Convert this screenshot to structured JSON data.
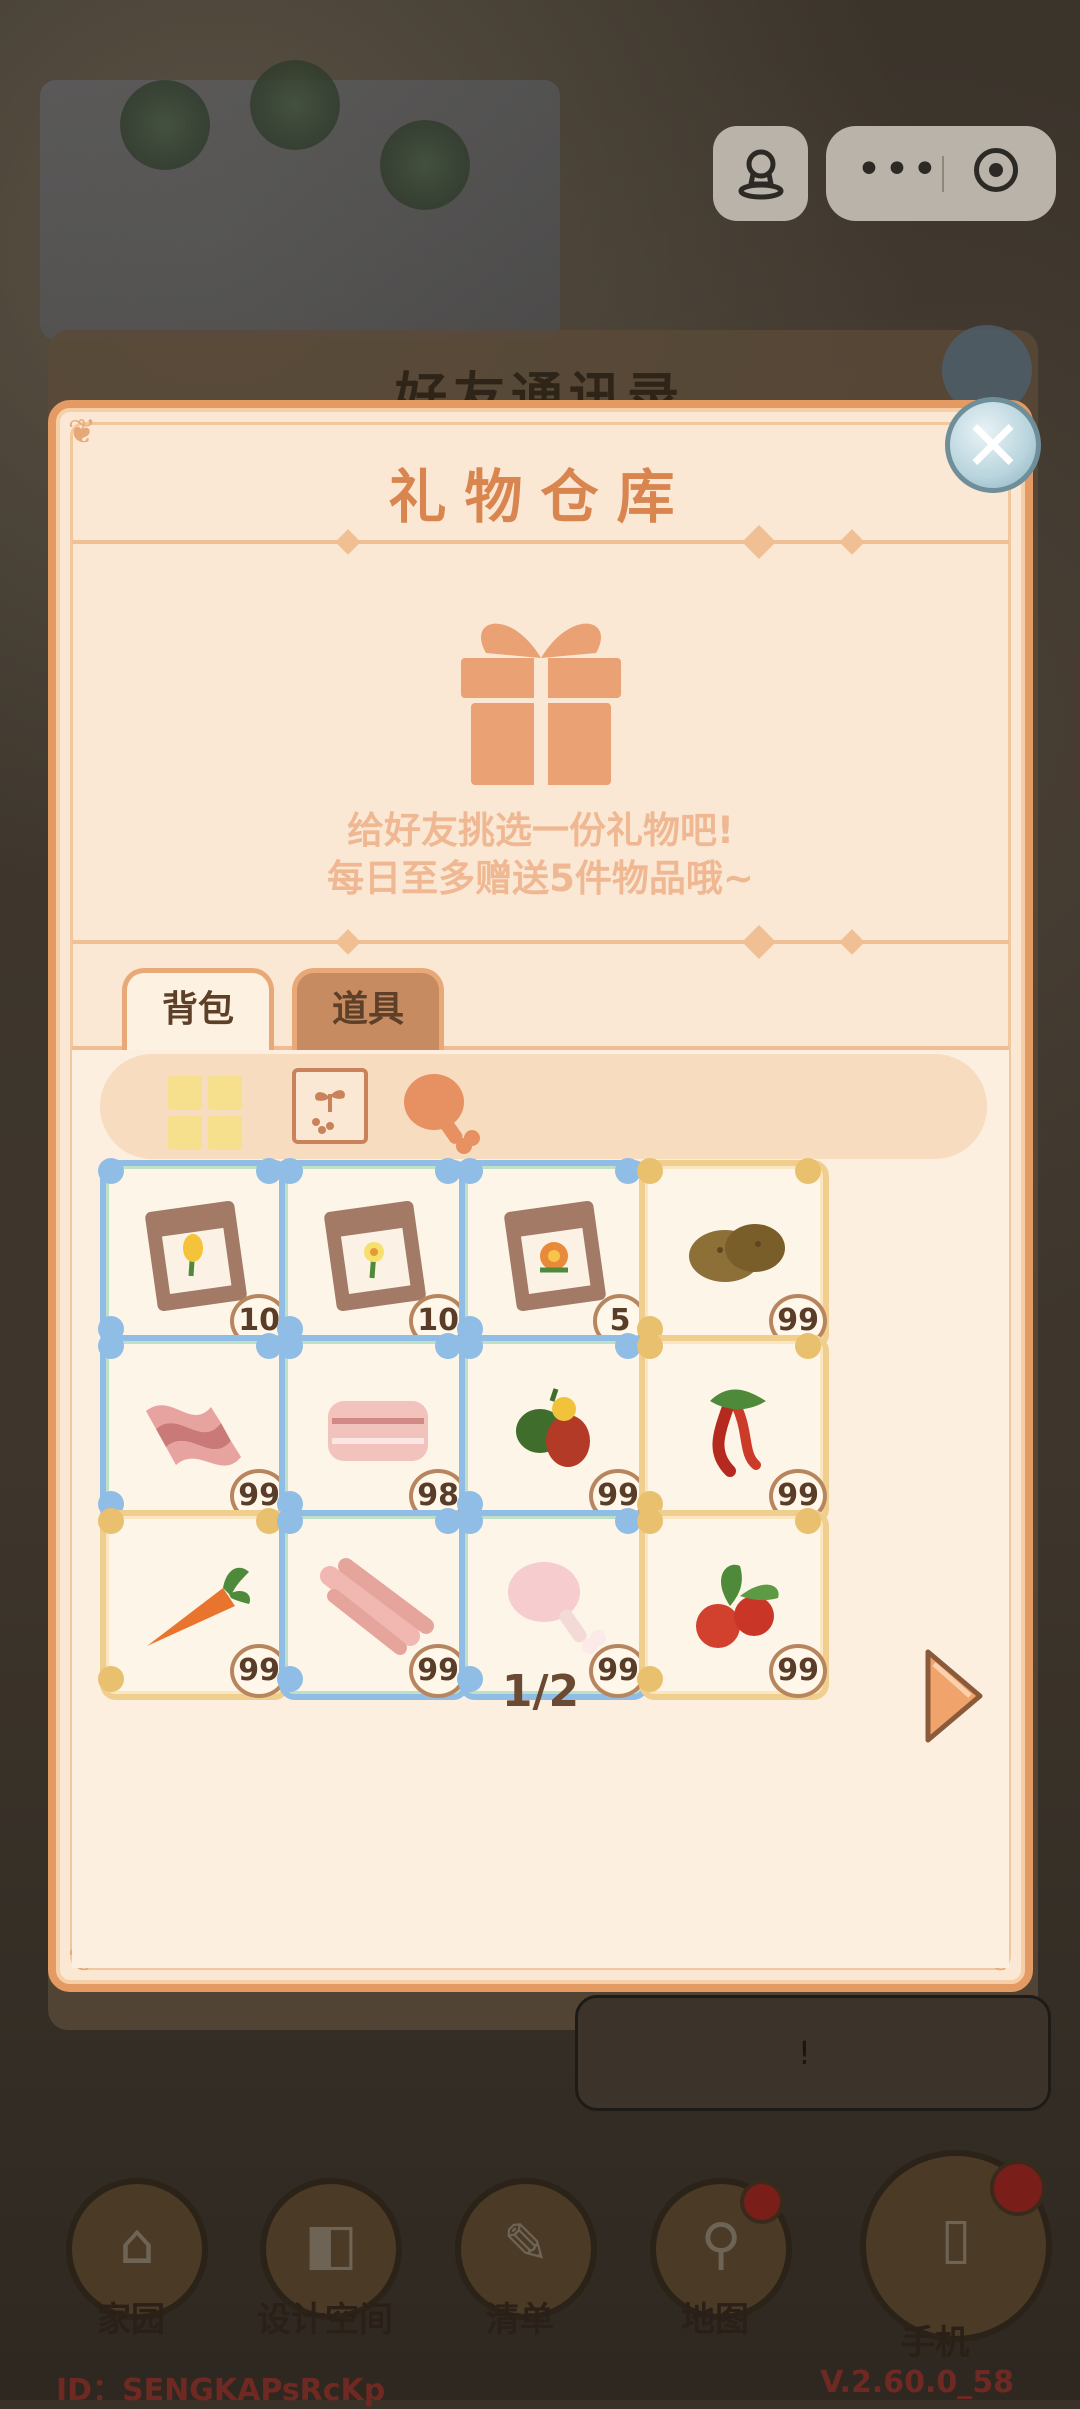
{
  "background": {
    "old_panel_title": "好友通讯录",
    "speech_mark": "!"
  },
  "capsule": {
    "share_icon": "stamp-icon",
    "more_icon": "more-dots-icon",
    "close_icon": "target-icon"
  },
  "modal": {
    "title": "礼物仓库",
    "gift_icon": "gift-box-icon",
    "hint_line1": "给好友挑选一份礼物吧!",
    "hint_line2": "每日至多赠送5件物品哦~",
    "close_icon": "close-icon"
  },
  "tabs": [
    {
      "label": "背包"
    },
    {
      "label": "道具"
    }
  ],
  "filters": [
    {
      "icon": "grid-icon"
    },
    {
      "icon": "seed-icon"
    },
    {
      "icon": "drumstick-icon"
    }
  ],
  "items": [
    {
      "icon": "tulip-seed-pack-icon",
      "count": "10",
      "frame": "blue"
    },
    {
      "icon": "daffodil-seed-pack-icon",
      "count": "10",
      "frame": "blue"
    },
    {
      "icon": "marigold-seed-pack-icon",
      "count": "5",
      "frame": "blue"
    },
    {
      "icon": "potato-icon",
      "count": "99",
      "frame": "gold"
    },
    {
      "icon": "bacon-icon",
      "count": "99",
      "frame": "blue"
    },
    {
      "icon": "pork-belly-icon",
      "count": "98",
      "frame": "blue"
    },
    {
      "icon": "bell-pepper-icon",
      "count": "99",
      "frame": "blue"
    },
    {
      "icon": "chili-pepper-icon",
      "count": "99",
      "frame": "gold"
    },
    {
      "icon": "carrot-icon",
      "count": "99",
      "frame": "gold"
    },
    {
      "icon": "ribs-icon",
      "count": "99",
      "frame": "blue"
    },
    {
      "icon": "chicken-leg-icon",
      "count": "99",
      "frame": "blue"
    },
    {
      "icon": "tomato-icon",
      "count": "99",
      "frame": "gold"
    }
  ],
  "pager": {
    "text": "1/2",
    "next_icon": "next-arrow-icon"
  },
  "bottom_nav": [
    {
      "label": "家园",
      "icon": "home-icon"
    },
    {
      "label": "设计空间",
      "icon": "design-icon"
    },
    {
      "label": "清单",
      "icon": "list-icon"
    },
    {
      "label": "地图",
      "icon": "map-pin-icon"
    },
    {
      "label": "手机",
      "icon": "phone-icon"
    }
  ],
  "footer": {
    "id_text": "ID：SENGKAPsRcKp",
    "version": "V.2.60.0_58"
  },
  "colors": {
    "accent": "#e39a63",
    "title": "#d98550",
    "panel": "#fbe8d4"
  }
}
